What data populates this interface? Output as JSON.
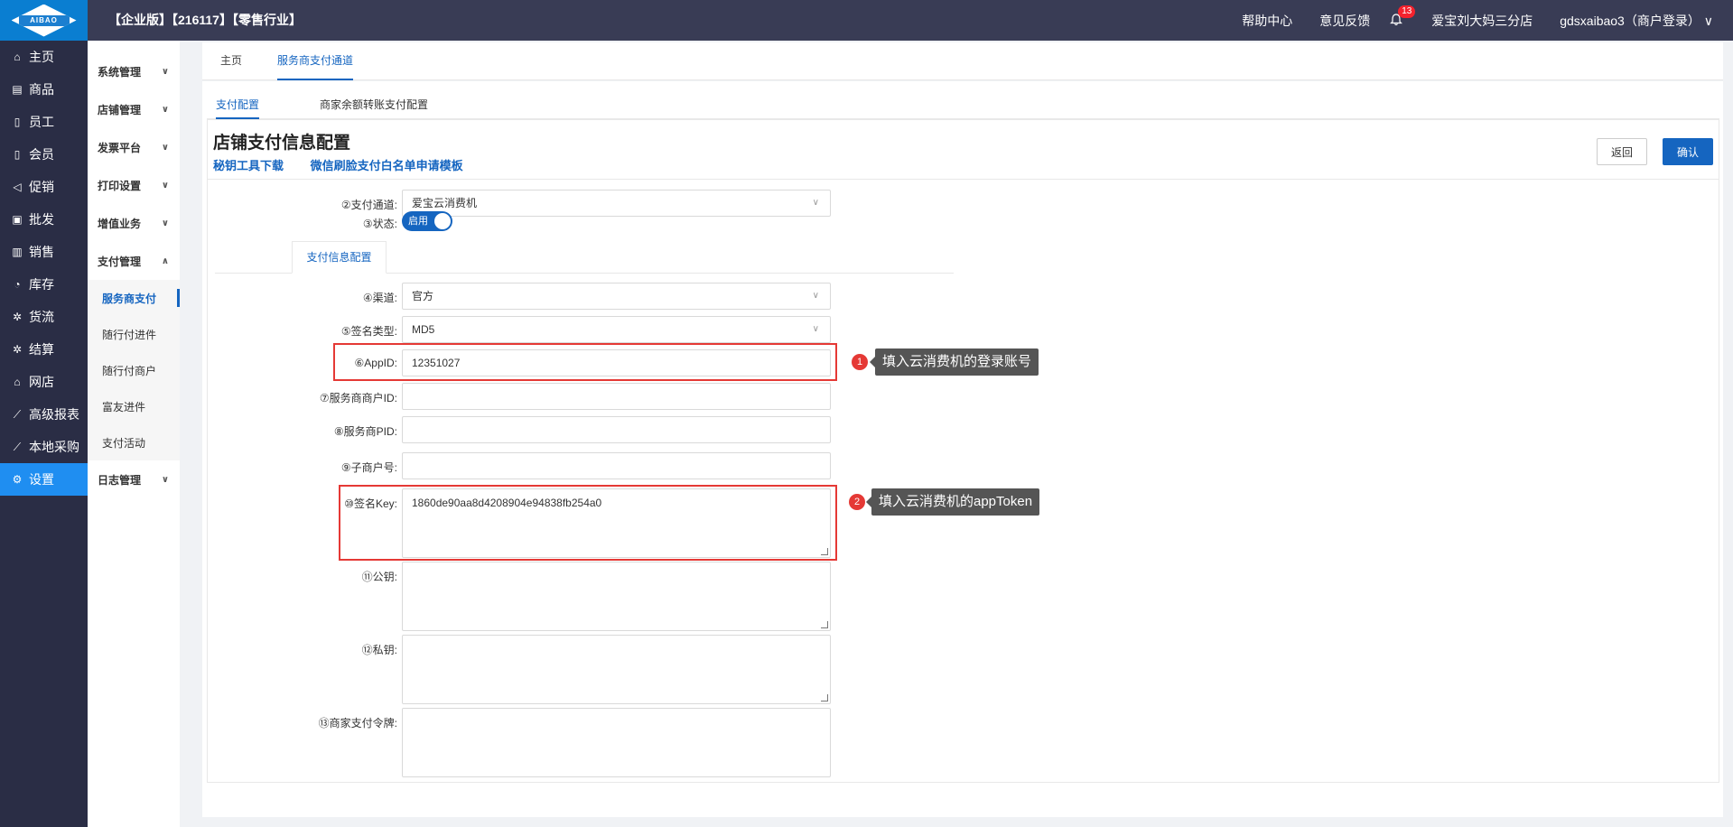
{
  "header": {
    "logo_text": "AIBAO",
    "title": "【企业版】【216117】【零售行业】",
    "help": "帮助中心",
    "feedback": "意见反馈",
    "notif_count": "13",
    "store": "爱宝刘大妈三分店",
    "user": "gdsxaibao3（商户登录）"
  },
  "leftnav": [
    {
      "label": "主页",
      "icon": "home-icon"
    },
    {
      "label": "商品",
      "icon": "goods-icon"
    },
    {
      "label": "员工",
      "icon": "staff-icon"
    },
    {
      "label": "会员",
      "icon": "member-icon"
    },
    {
      "label": "促销",
      "icon": "megaphone-icon"
    },
    {
      "label": "批发",
      "icon": "wholesale-icon"
    },
    {
      "label": "销售",
      "icon": "chart-icon"
    },
    {
      "label": "库存",
      "icon": "stock-icon"
    },
    {
      "label": "货流",
      "icon": "flow-icon"
    },
    {
      "label": "结算",
      "icon": "settle-icon"
    },
    {
      "label": "网店",
      "icon": "shop-icon"
    },
    {
      "label": "高级报表",
      "icon": "report-icon"
    },
    {
      "label": "本地采购",
      "icon": "purchase-icon"
    },
    {
      "label": "设置",
      "icon": "gear-icon"
    }
  ],
  "subnav": {
    "g1": "系统管理",
    "g2": "店铺管理",
    "g3": "发票平台",
    "g4": "打印设置",
    "g5": "增值业务",
    "g6": "支付管理",
    "c1": "服务商支付",
    "c2": "随行付进件",
    "c3": "随行付商户",
    "c4": "富友进件",
    "c5": "支付活动",
    "g7": "日志管理"
  },
  "tabs": {
    "home": "主页",
    "current": "服务商支付通道"
  },
  "subtabs": {
    "pay_config": "支付配置",
    "transfer_config": "商家余额转账支付配置"
  },
  "page": {
    "title": "店铺支付信息配置",
    "link1": "秘钥工具下载",
    "link2": "微信刷脸支付白名单申请模板",
    "back": "返回",
    "confirm": "确认"
  },
  "form": {
    "channel_label": "②支付通道:",
    "channel_value": "爱宝云消费机",
    "status_label": "③状态:",
    "status_value": "启用",
    "inner_tab": "支付信息配置",
    "route_label": "④渠道:",
    "route_value": "官方",
    "sign_type_label": "⑤签名类型:",
    "sign_type_value": "MD5",
    "appid_label": "⑥AppID:",
    "appid_value": "12351027",
    "merchant_id_label": "⑦服务商商户ID:",
    "merchant_id_value": "",
    "pid_label": "⑧服务商PID:",
    "pid_value": "",
    "sub_merchant_label": "⑨子商户号:",
    "sub_merchant_value": "",
    "sign_key_label": "⑩签名Key:",
    "sign_key_value": "1860de90aa8d4208904e94838fb254a0",
    "public_key_label": "⑪公钥:",
    "private_key_label": "⑫私钥:",
    "token_label": "⑬商家支付令牌:"
  },
  "annotations": {
    "n1": "1",
    "tip1": "填入云消费机的登录账号",
    "n2": "2",
    "tip2": "填入云消费机的appToken"
  }
}
